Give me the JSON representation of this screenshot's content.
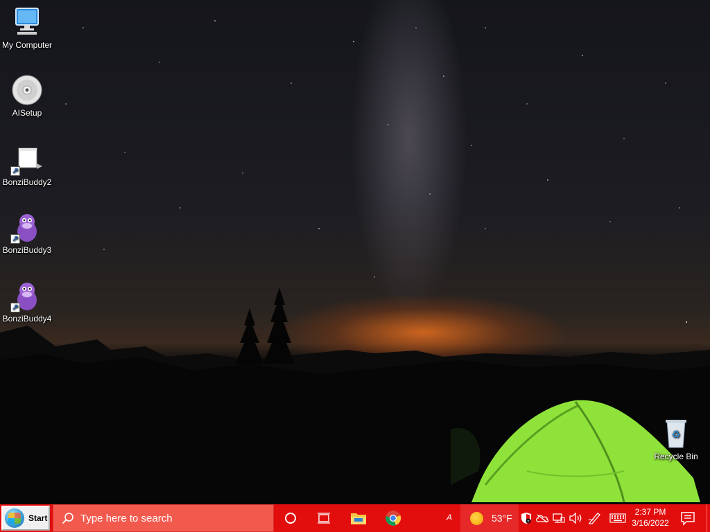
{
  "desktop": {
    "icons": [
      {
        "label": "My Computer",
        "icon": "computer-icon"
      },
      {
        "label": "AISetup",
        "icon": "cd-disc-icon"
      },
      {
        "label": "BonziBuddy2",
        "icon": "folder-shortcut-icon"
      },
      {
        "label": "BonziBuddy3",
        "icon": "bonzi-gorilla-icon"
      },
      {
        "label": "BonziBuddy4",
        "icon": "bonzi-gorilla-icon"
      },
      {
        "label": "Recycle Bin",
        "icon": "recycle-bin-icon"
      }
    ]
  },
  "taskbar": {
    "start_label": "Start",
    "search_placeholder": "Type here to search",
    "pinned": [
      {
        "name": "cortana",
        "icon": "cortana-circle-icon"
      },
      {
        "name": "task-view",
        "icon": "task-view-icon"
      },
      {
        "name": "file-explorer",
        "icon": "folder-icon"
      },
      {
        "name": "chrome",
        "icon": "chrome-icon"
      }
    ],
    "tray_letter": "A",
    "weather": {
      "temperature": "53°F",
      "icon": "sun-icon"
    },
    "tray_icons": [
      "security-shield-icon",
      "onedrive-icon",
      "network-icon",
      "volume-icon",
      "pen-icon",
      "keyboard-icon"
    ],
    "clock": {
      "time": "2:37 PM",
      "date": "3/16/2022"
    },
    "notification_icon": "action-center-icon"
  },
  "colors": {
    "taskbar": "#e20e0e",
    "search_box": "#f25a4e",
    "tent": "#8fe23a"
  }
}
